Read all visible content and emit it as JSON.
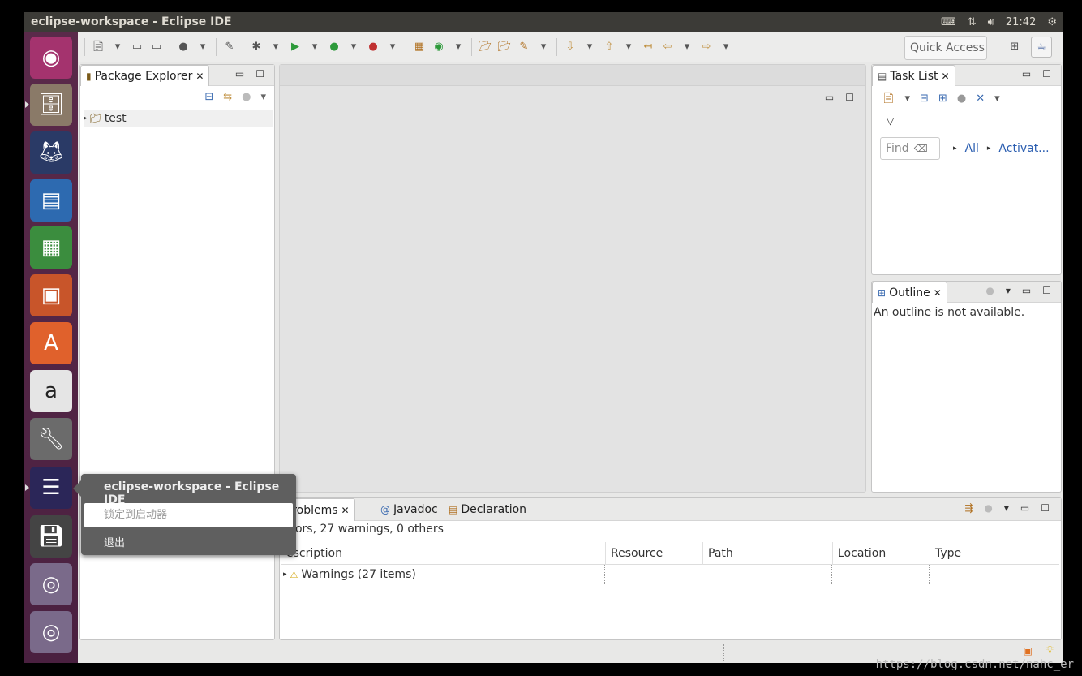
{
  "window": {
    "title": "eclipse-workspace - Eclipse IDE"
  },
  "system_tray": {
    "time": "21:42"
  },
  "toolbar": {
    "quick_access": "Quick Access"
  },
  "package_explorer": {
    "tab_label": "Package Explorer",
    "tree": [
      {
        "label": "test"
      }
    ]
  },
  "task_list": {
    "tab_label": "Task List",
    "find_placeholder": "Find",
    "filter_all": "All",
    "filter_activate": "Activat..."
  },
  "outline": {
    "tab_label": "Outline",
    "message": "An outline is not available."
  },
  "problems": {
    "tabs": [
      "Problems",
      "Javadoc",
      "Declaration"
    ],
    "summary": "rrors, 27 warnings, 0 others",
    "columns": [
      "escription",
      "Resource",
      "Path",
      "Location",
      "Type"
    ],
    "rows": [
      {
        "label": "Warnings (27 items)"
      }
    ]
  },
  "launcher_popup": {
    "title": "eclipse-workspace - Eclipse IDE",
    "items": [
      "锁定到启动器",
      "退出"
    ]
  },
  "watermark": "https://blog.csdn.net/nahc_er"
}
